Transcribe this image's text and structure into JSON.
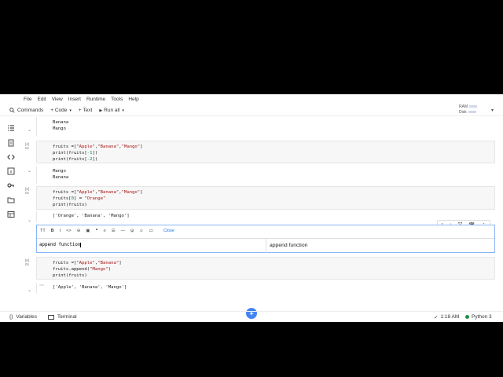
{
  "menu": [
    "File",
    "Edit",
    "View",
    "Insert",
    "Runtime",
    "Tools",
    "Help"
  ],
  "toolbar": {
    "commands": "Commands",
    "code": "+ Code",
    "text": "+ Text",
    "run_all": "Run all",
    "ram": "RAM",
    "disk": "Disk"
  },
  "cells": {
    "top_output": [
      "Banana",
      "Mango"
    ],
    "cell4": {
      "exec": "[4]",
      "time": "0s",
      "code": [
        "fruits =[\"Apple\",\"Banana\",\"Mango\"]",
        "print(fruits[-1])",
        "print(fruits[-2])"
      ],
      "output": [
        "Mango",
        "Banana"
      ]
    },
    "cell5": {
      "exec": "[5]",
      "time": "0s",
      "code": [
        "fruits =[\"Apple\",\"Banana\",\"Mango\"]",
        "fruits[0] = \"Orange\"",
        "print(fruits)"
      ],
      "output": "['Orange', 'Banana', 'Mango']"
    },
    "text_cell": {
      "close": "Close",
      "source": "append function",
      "preview": "append function"
    },
    "cell6": {
      "exec": "[6]",
      "time": "0s",
      "code": [
        "fruits =[\"Apple\",\"Banana\"]",
        "fruits.append(\"Mango\")",
        "print(fruits)"
      ],
      "output": "['Apple', 'Banana', 'Mango']"
    }
  },
  "status": {
    "variables": "Variables",
    "terminal": "Terminal",
    "time": "1:18 AM",
    "runtime": "Python 3"
  },
  "colors": {
    "accent": "#1a73e8",
    "string": "#a31515",
    "number": "#098658"
  }
}
